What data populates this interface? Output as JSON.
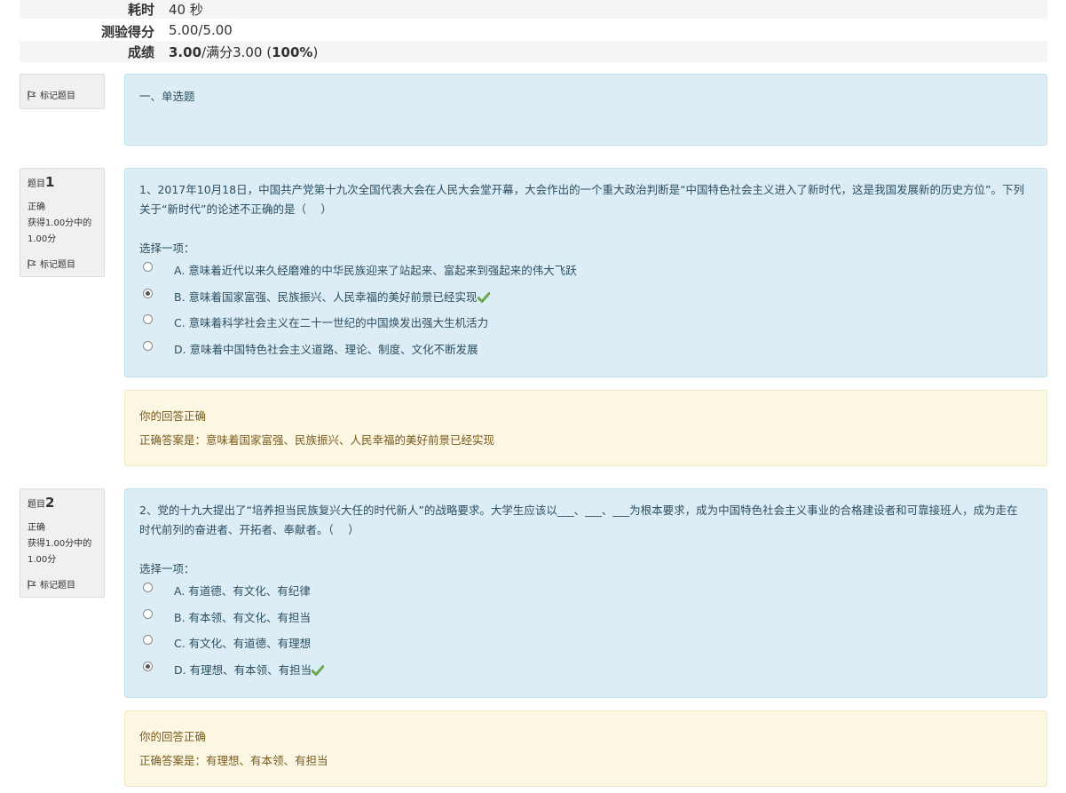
{
  "summary": {
    "time_label": "耗时",
    "time_value": "40 秒",
    "score_label": "测验得分",
    "score_value": "5.00/5.00",
    "grade_label": "成绩",
    "grade_bold": "3.00",
    "grade_mid": "/满分3.00 (",
    "grade_pct": "100%",
    "grade_end": ")"
  },
  "section": {
    "flag_label": "标记题目",
    "title": "一、单选题"
  },
  "questions": [
    {
      "no_prefix": "题目",
      "no": "1",
      "status": "正确",
      "grade": "获得1.00分中的1.00分",
      "flag_label": "标记题目",
      "text": "1、2017年10月18日，中国共产党第十九次全国代表大会在人民大会堂开幕，大会作出的一个重大政治判断是“中国特色社会主义进入了新时代，这是我国发展新的历史方位”。下列关于“新时代”的论述不正确的是（　 ）",
      "prompt": "选择一项：",
      "options": [
        "A. 意味着近代以来久经磨难的中华民族迎来了站起来、富起来到强起来的伟大飞跃",
        "B. 意味着国家富强、民族振兴、人民幸福的美好前景已经实现",
        "C. 意味着科学社会主义在二十一世纪的中国焕发出强大生机活力",
        "D. 意味着中国特色社会主义道路、理论、制度、文化不断发展"
      ],
      "selected": 1,
      "feedback": "你的回答正确",
      "answer": "正确答案是：意味着国家富强、民族振兴、人民幸福的美好前景已经实现"
    },
    {
      "no_prefix": "题目",
      "no": "2",
      "status": "正确",
      "grade": "获得1.00分中的1.00分",
      "flag_label": "标记题目",
      "text": "2、党的十九大提出了“培养担当民族复兴大任的时代新人”的战略要求。大学生应该以___、___、___为根本要求，成为中国特色社会主义事业的合格建设者和可靠接班人，成为走在时代前列的奋进者、开拓者、奉献者。（　 ）",
      "prompt": "选择一项：",
      "options": [
        "A. 有道德、有文化、有纪律",
        "B. 有本领、有文化、有担当",
        "C. 有文化、有道德、有理想",
        "D. 有理想、有本领、有担当"
      ],
      "selected": 3,
      "feedback": "你的回答正确",
      "answer": "正确答案是：有理想、有本领、有担当"
    }
  ],
  "colors": {
    "question_bg": "#dcedf5",
    "feedback_bg": "#fcf7e3",
    "check": "#6aa84f"
  },
  "icons": {
    "flag": "flag-icon",
    "check": "check-icon",
    "radio": "radio-icon"
  }
}
